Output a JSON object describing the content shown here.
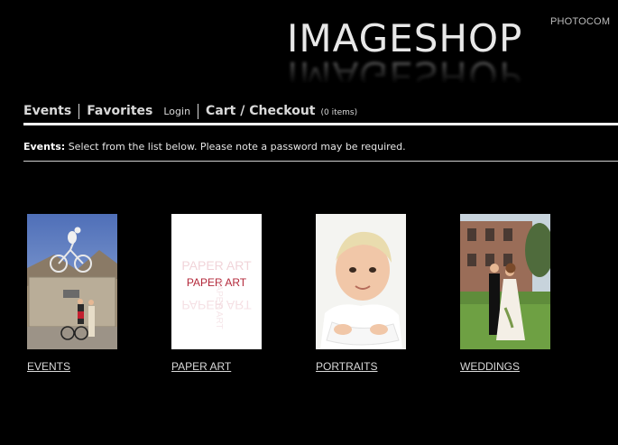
{
  "header": {
    "brand": "PHOTOCOM",
    "logo_text": "IMAGESHOP"
  },
  "nav": {
    "events": "Events",
    "favorites": "Favorites",
    "login": "Login",
    "cart": "Cart / Checkout",
    "cart_count": "(0 items)"
  },
  "info": {
    "label": "Events:",
    "text": "Select from the list below. Please note a password may be required."
  },
  "gallery": [
    {
      "caption": "EVENTS",
      "icon": "cycling-event-photo"
    },
    {
      "caption": "PAPER ART",
      "icon": "paper-art-photo",
      "thumb_text": "PAPER ART"
    },
    {
      "caption": "PORTRAITS",
      "icon": "child-portrait-photo"
    },
    {
      "caption": "WEDDINGS",
      "icon": "wedding-couple-photo"
    }
  ],
  "colors": {
    "background": "#000000",
    "text": "#d9d9d9",
    "paper_art_red": "#b3283a"
  }
}
